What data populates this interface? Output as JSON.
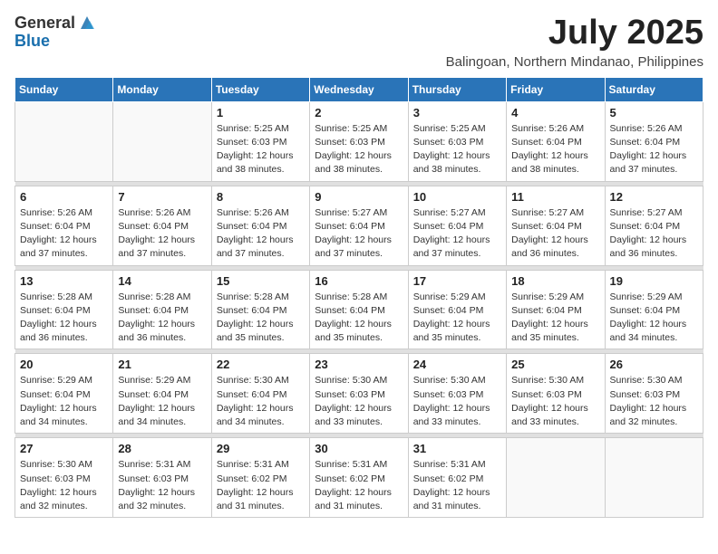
{
  "header": {
    "logo_general": "General",
    "logo_blue": "Blue",
    "month_year": "July 2025",
    "location": "Balingoan, Northern Mindanao, Philippines"
  },
  "days_of_week": [
    "Sunday",
    "Monday",
    "Tuesday",
    "Wednesday",
    "Thursday",
    "Friday",
    "Saturday"
  ],
  "weeks": [
    [
      {
        "day": "",
        "info": ""
      },
      {
        "day": "",
        "info": ""
      },
      {
        "day": "1",
        "info": "Sunrise: 5:25 AM\nSunset: 6:03 PM\nDaylight: 12 hours and 38 minutes."
      },
      {
        "day": "2",
        "info": "Sunrise: 5:25 AM\nSunset: 6:03 PM\nDaylight: 12 hours and 38 minutes."
      },
      {
        "day": "3",
        "info": "Sunrise: 5:25 AM\nSunset: 6:03 PM\nDaylight: 12 hours and 38 minutes."
      },
      {
        "day": "4",
        "info": "Sunrise: 5:26 AM\nSunset: 6:04 PM\nDaylight: 12 hours and 38 minutes."
      },
      {
        "day": "5",
        "info": "Sunrise: 5:26 AM\nSunset: 6:04 PM\nDaylight: 12 hours and 37 minutes."
      }
    ],
    [
      {
        "day": "6",
        "info": "Sunrise: 5:26 AM\nSunset: 6:04 PM\nDaylight: 12 hours and 37 minutes."
      },
      {
        "day": "7",
        "info": "Sunrise: 5:26 AM\nSunset: 6:04 PM\nDaylight: 12 hours and 37 minutes."
      },
      {
        "day": "8",
        "info": "Sunrise: 5:26 AM\nSunset: 6:04 PM\nDaylight: 12 hours and 37 minutes."
      },
      {
        "day": "9",
        "info": "Sunrise: 5:27 AM\nSunset: 6:04 PM\nDaylight: 12 hours and 37 minutes."
      },
      {
        "day": "10",
        "info": "Sunrise: 5:27 AM\nSunset: 6:04 PM\nDaylight: 12 hours and 37 minutes."
      },
      {
        "day": "11",
        "info": "Sunrise: 5:27 AM\nSunset: 6:04 PM\nDaylight: 12 hours and 36 minutes."
      },
      {
        "day": "12",
        "info": "Sunrise: 5:27 AM\nSunset: 6:04 PM\nDaylight: 12 hours and 36 minutes."
      }
    ],
    [
      {
        "day": "13",
        "info": "Sunrise: 5:28 AM\nSunset: 6:04 PM\nDaylight: 12 hours and 36 minutes."
      },
      {
        "day": "14",
        "info": "Sunrise: 5:28 AM\nSunset: 6:04 PM\nDaylight: 12 hours and 36 minutes."
      },
      {
        "day": "15",
        "info": "Sunrise: 5:28 AM\nSunset: 6:04 PM\nDaylight: 12 hours and 35 minutes."
      },
      {
        "day": "16",
        "info": "Sunrise: 5:28 AM\nSunset: 6:04 PM\nDaylight: 12 hours and 35 minutes."
      },
      {
        "day": "17",
        "info": "Sunrise: 5:29 AM\nSunset: 6:04 PM\nDaylight: 12 hours and 35 minutes."
      },
      {
        "day": "18",
        "info": "Sunrise: 5:29 AM\nSunset: 6:04 PM\nDaylight: 12 hours and 35 minutes."
      },
      {
        "day": "19",
        "info": "Sunrise: 5:29 AM\nSunset: 6:04 PM\nDaylight: 12 hours and 34 minutes."
      }
    ],
    [
      {
        "day": "20",
        "info": "Sunrise: 5:29 AM\nSunset: 6:04 PM\nDaylight: 12 hours and 34 minutes."
      },
      {
        "day": "21",
        "info": "Sunrise: 5:29 AM\nSunset: 6:04 PM\nDaylight: 12 hours and 34 minutes."
      },
      {
        "day": "22",
        "info": "Sunrise: 5:30 AM\nSunset: 6:04 PM\nDaylight: 12 hours and 34 minutes."
      },
      {
        "day": "23",
        "info": "Sunrise: 5:30 AM\nSunset: 6:03 PM\nDaylight: 12 hours and 33 minutes."
      },
      {
        "day": "24",
        "info": "Sunrise: 5:30 AM\nSunset: 6:03 PM\nDaylight: 12 hours and 33 minutes."
      },
      {
        "day": "25",
        "info": "Sunrise: 5:30 AM\nSunset: 6:03 PM\nDaylight: 12 hours and 33 minutes."
      },
      {
        "day": "26",
        "info": "Sunrise: 5:30 AM\nSunset: 6:03 PM\nDaylight: 12 hours and 32 minutes."
      }
    ],
    [
      {
        "day": "27",
        "info": "Sunrise: 5:30 AM\nSunset: 6:03 PM\nDaylight: 12 hours and 32 minutes."
      },
      {
        "day": "28",
        "info": "Sunrise: 5:31 AM\nSunset: 6:03 PM\nDaylight: 12 hours and 32 minutes."
      },
      {
        "day": "29",
        "info": "Sunrise: 5:31 AM\nSunset: 6:02 PM\nDaylight: 12 hours and 31 minutes."
      },
      {
        "day": "30",
        "info": "Sunrise: 5:31 AM\nSunset: 6:02 PM\nDaylight: 12 hours and 31 minutes."
      },
      {
        "day": "31",
        "info": "Sunrise: 5:31 AM\nSunset: 6:02 PM\nDaylight: 12 hours and 31 minutes."
      },
      {
        "day": "",
        "info": ""
      },
      {
        "day": "",
        "info": ""
      }
    ]
  ]
}
